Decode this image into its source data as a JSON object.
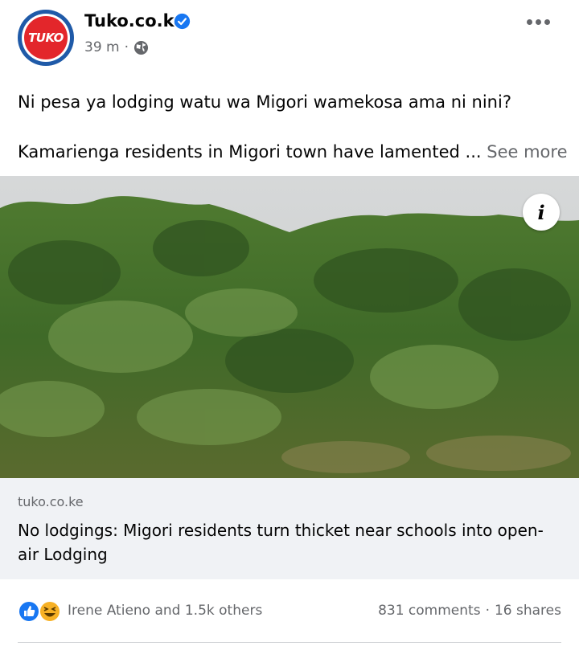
{
  "post": {
    "page_name": "Tuko.co.ke",
    "logo_text": "TUKO",
    "time": "39 m",
    "separator": "·",
    "text_line1": "Ni pesa ya lodging watu wa Migori wamekosa ama ni nini?",
    "text_line2": "Kamarienga residents in Migori town have lamented ...",
    "see_more": "See more"
  },
  "link": {
    "domain": "tuko.co.ke",
    "title": "No lodgings: Migori residents turn thicket near schools into open-air Lodging",
    "info_label": "i"
  },
  "engagement": {
    "reactors": "Irene Atieno and 1.5k others",
    "comments": "831 comments",
    "dot": "·",
    "shares": "16 shares"
  },
  "colors": {
    "brand_red": "#e3262b",
    "verified_blue": "#1877f2",
    "like_blue": "#1877f2",
    "haha_yellow": "#f7b125"
  }
}
